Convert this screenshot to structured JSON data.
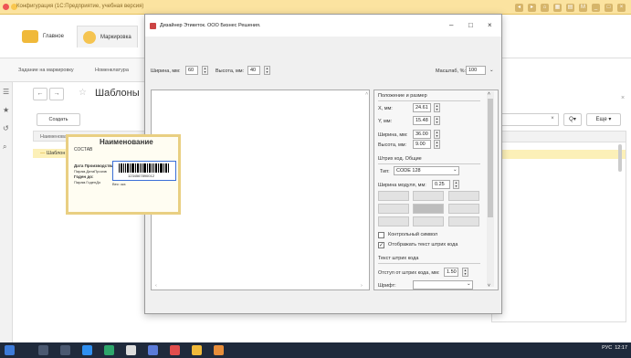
{
  "app": {
    "title": "Конфигурация (1С:Предприятие, учебная версия)",
    "sections": {
      "main": "Главное",
      "marking": "Маркировка"
    },
    "open_tabs": [
      "Задание на маркировку",
      "Номенклатура"
    ],
    "page_title": "Шаблоны",
    "create_label": "Создать",
    "column_header": "Наименование",
    "row_item": "Шаблон 1",
    "more_label": "Еще",
    "search_btn": "Q▾",
    "clear": "×"
  },
  "designer": {
    "title": "Дизайнер Этикеток. ООО Бизнес Решения.",
    "width_label": "Ширина, мм:",
    "width_value": "60",
    "height_label": "Высота, мм:",
    "height_value": "40",
    "scale_label": "Масштаб, %:",
    "scale_value": "100",
    "label": {
      "heading": "Наименование",
      "composition": "СОСТАВ",
      "prod_date_label": "Дата Производства",
      "prod_date_param": "Парам.ДатаПроизв",
      "valid_label": "Годен до:",
      "valid_param": "Парам.ГоденДо",
      "barcode_number": "1234567890012",
      "extra": "Вес:   ккз"
    },
    "props": {
      "pos_group": "Положение и размер",
      "x_label": "X, мм:",
      "x_value": "24.61",
      "y_label": "Y, мм:",
      "y_value": "15.48",
      "w_label": "Ширина, мм:",
      "w_value": "36.00",
      "h_label": "Высота, мм:",
      "h_value": "9.00",
      "barcode_group": "Штрих код. Общие",
      "type_label": "Тип:",
      "type_value": "CODE 128",
      "module_label": "Ширина модуля, мм:",
      "module_value": "0.25",
      "control_symbol": "Контрольный символ",
      "show_text": "Отображать текст штрих кода",
      "text_group": "Текст штрих кода",
      "offset_label": "Отступ от штрих кода, мм:",
      "offset_value": "1.50",
      "font_label": "Шрифт:"
    }
  },
  "taskbar": {
    "lang": "РУС",
    "time": "12:17"
  },
  "colors": {
    "accent": "#fcf0b8",
    "title_bar": "#fbe3a0",
    "taskbar": "#1f2a3c"
  }
}
